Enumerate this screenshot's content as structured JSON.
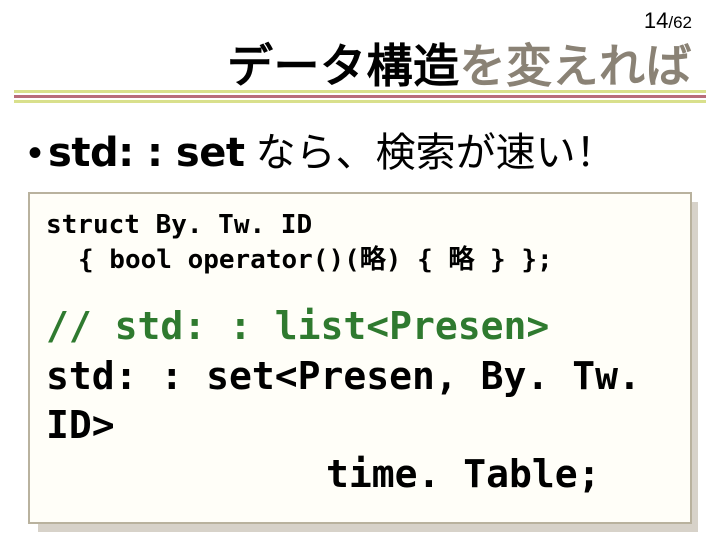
{
  "page": {
    "current": "14",
    "total": "62"
  },
  "title": {
    "part1": "データ構造",
    "part2": "を変えれば"
  },
  "bullet": {
    "marker": "•",
    "code": "std: : set",
    "text": "なら、検索が速い！"
  },
  "code": {
    "struct_line1": "struct By. Tw. ID",
    "struct_line2": "{ bool operator()(略) { 略 } };",
    "comment": "// std: : list<Presen>",
    "set_line": "std: : set<Presen, By. Tw. ID>",
    "var_line": "time. Table;"
  }
}
